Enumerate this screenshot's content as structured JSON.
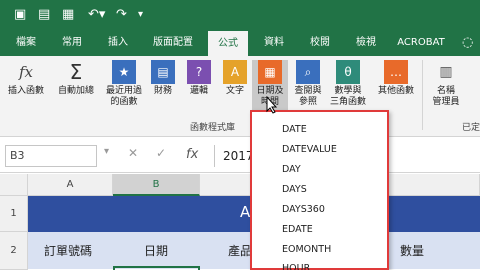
{
  "colors": {
    "brand": "#217346",
    "title_bg": "#2f4f9f",
    "header_bg": "#d9e1f2",
    "highlight_border": "#e03a3a"
  },
  "qat": {
    "icons": [
      "save-icon",
      "autosave-icon",
      "save-disk-icon",
      "undo-icon",
      "redo-icon",
      "customize-qat-icon"
    ]
  },
  "tabs": [
    {
      "label": "檔案"
    },
    {
      "label": "常用"
    },
    {
      "label": "插入"
    },
    {
      "label": "版面配置"
    },
    {
      "label": "公式",
      "active": true
    },
    {
      "label": "資料"
    },
    {
      "label": "校閱"
    },
    {
      "label": "檢視"
    },
    {
      "label": "ACROBAT"
    }
  ],
  "ribbon": {
    "buttons": [
      {
        "label": "插入函數",
        "icon": "fx"
      },
      {
        "label1": "自動加總",
        "icon": "Σ"
      },
      {
        "label1": "最近用過",
        "label2": "的函數",
        "icon": "★"
      },
      {
        "label1": "財務",
        "icon": "▤"
      },
      {
        "label1": "邏輯",
        "icon": "?"
      },
      {
        "label1": "文字",
        "icon": "A"
      },
      {
        "label1": "日期及",
        "label2": "時間",
        "icon": "▦"
      },
      {
        "label1": "查閱與",
        "label2": "參照",
        "icon": "⌕"
      },
      {
        "label1": "數學與",
        "label2": "三角函數",
        "icon": "θ"
      },
      {
        "label1": "其他函數",
        "icon": "…"
      },
      {
        "label1": "名稱",
        "label2": "管理員",
        "icon": "▥"
      }
    ],
    "group_label": "函數程式庫",
    "group_label_right": "已定"
  },
  "formula_bar": {
    "name_box": "B3",
    "value": "2017"
  },
  "columns": [
    "A",
    "B"
  ],
  "rows": [
    "1",
    "2"
  ],
  "sheet": {
    "title": "ABC",
    "headers": [
      "訂單號碼",
      "日期",
      "產品",
      "數量"
    ]
  },
  "dropdown": {
    "items": [
      "DATE",
      "DATEVALUE",
      "DAY",
      "DAYS",
      "DAYS360",
      "EDATE",
      "EOMONTH",
      "HOUR"
    ]
  }
}
